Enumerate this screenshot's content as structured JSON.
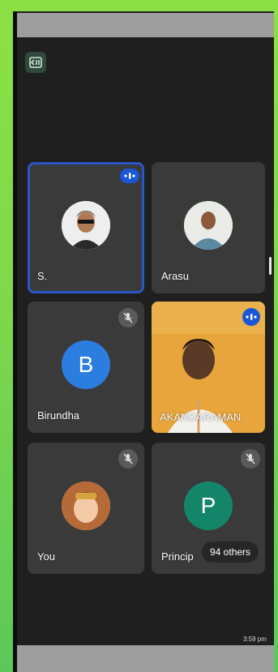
{
  "participants": [
    {
      "name": "S.",
      "status": "speaking"
    },
    {
      "name": "Arasu",
      "status": "none"
    },
    {
      "name": "Birundha",
      "status": "muted",
      "initial": "B",
      "color": "#2b7de0"
    },
    {
      "name": "AKANDARAMAN",
      "status": "speaking"
    },
    {
      "name": "You",
      "status": "muted"
    },
    {
      "name": "Princip",
      "status": "muted",
      "initial": "P",
      "color": "#13866a"
    }
  ],
  "others_label": "94 others",
  "clock": "3:59 pm",
  "colors": {
    "accent": "#1a57d6",
    "tile_bg": "#3a3a3a",
    "screen_bg": "#1f1f1f",
    "outer_bg": "#7fd84a"
  }
}
